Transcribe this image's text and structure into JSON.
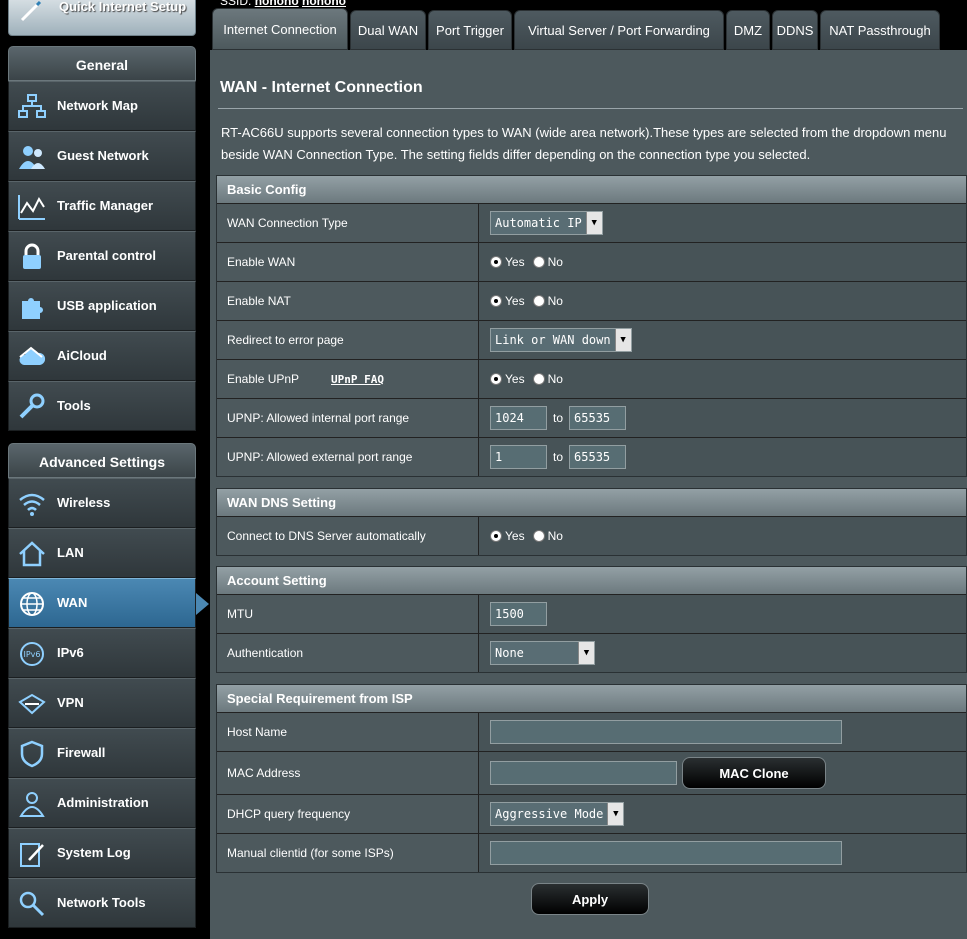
{
  "sidebar": {
    "qis_label": "Quick Internet Setup",
    "general": {
      "heading": "General",
      "items": [
        {
          "label": "Network Map",
          "icon": "network-map-icon"
        },
        {
          "label": "Guest Network",
          "icon": "guest-network-icon"
        },
        {
          "label": "Traffic Manager",
          "icon": "traffic-manager-icon"
        },
        {
          "label": "Parental control",
          "icon": "lock-icon"
        },
        {
          "label": "USB application",
          "icon": "puzzle-icon"
        },
        {
          "label": "AiCloud",
          "icon": "cloud-icon"
        },
        {
          "label": "Tools",
          "icon": "wrench-icon"
        }
      ]
    },
    "advanced": {
      "heading": "Advanced Settings",
      "items": [
        {
          "label": "Wireless",
          "icon": "wifi-icon"
        },
        {
          "label": "LAN",
          "icon": "home-icon"
        },
        {
          "label": "WAN",
          "icon": "globe-icon",
          "active": true
        },
        {
          "label": "IPv6",
          "icon": "ipv6-icon"
        },
        {
          "label": "VPN",
          "icon": "vpn-icon"
        },
        {
          "label": "Firewall",
          "icon": "shield-icon"
        },
        {
          "label": "Administration",
          "icon": "admin-icon"
        },
        {
          "label": "System Log",
          "icon": "log-icon"
        },
        {
          "label": "Network Tools",
          "icon": "network-tools-icon"
        }
      ]
    }
  },
  "header": {
    "ssid_label": "SSID:",
    "ssid_1": "honoho",
    "ssid_2": "honoho"
  },
  "tabs": [
    {
      "label": "Internet Connection",
      "active": true
    },
    {
      "label": "Dual WAN"
    },
    {
      "label": "Port Trigger"
    },
    {
      "label": "Virtual Server / Port Forwarding"
    },
    {
      "label": "DMZ"
    },
    {
      "label": "DDNS"
    },
    {
      "label": "NAT Passthrough"
    }
  ],
  "page": {
    "title": "WAN - Internet Connection",
    "description": "RT-AC66U supports several connection types to WAN (wide area network).These types are selected from the dropdown menu beside WAN Connection Type. The setting fields differ depending on the connection type you selected."
  },
  "basic_config": {
    "heading": "Basic Config",
    "wan_type_label": "WAN Connection Type",
    "wan_type_value": "Automatic IP",
    "enable_wan_label": "Enable WAN",
    "enable_nat_label": "Enable NAT",
    "redirect_label": "Redirect to error page",
    "redirect_value": "Link or WAN down",
    "upnp_label": "Enable UPnP",
    "upnp_faq": "UPnP FAQ",
    "int_range_label": "UPNP: Allowed internal port range",
    "int_from": "1024",
    "int_to": "65535",
    "ext_range_label": "UPNP: Allowed external port range",
    "ext_from": "1",
    "ext_to": "65535",
    "to_word": "to",
    "yes": "Yes",
    "no": "No"
  },
  "dns": {
    "heading": "WAN DNS Setting",
    "auto_label": "Connect to DNS Server automatically"
  },
  "account": {
    "heading": "Account Setting",
    "mtu_label": "MTU",
    "mtu_value": "1500",
    "auth_label": "Authentication",
    "auth_value": "None"
  },
  "isp": {
    "heading": "Special Requirement from ISP",
    "host_label": "Host Name",
    "host_value": "",
    "mac_label": "MAC Address",
    "mac_value": "",
    "mac_clone": "MAC Clone",
    "dhcp_label": "DHCP query frequency",
    "dhcp_value": "Aggressive Mode",
    "clientid_label": "Manual clientid (for some ISPs)",
    "clientid_value": ""
  },
  "apply_label": "Apply",
  "colors": {
    "active": "#4b88b3",
    "panel": "#4d595d"
  }
}
